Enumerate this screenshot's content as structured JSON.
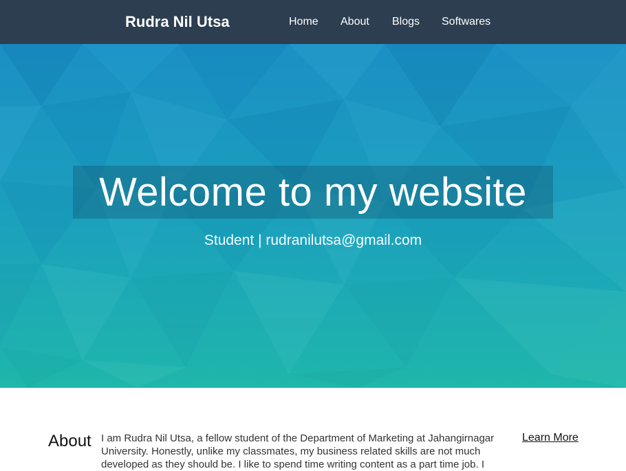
{
  "navbar": {
    "brand": "Rudra Nil Utsa",
    "links": [
      {
        "label": "Home"
      },
      {
        "label": "About"
      },
      {
        "label": "Blogs"
      },
      {
        "label": "Softwares"
      }
    ],
    "background_color": "#2c3e50"
  },
  "hero": {
    "title": "Welcome to my website",
    "subtitle": "Student | rudranilutsa@gmail.com",
    "colors": {
      "top": "#1b8fc4",
      "bottom": "#1fb6ab"
    }
  },
  "about": {
    "heading": "About",
    "text": "I am Rudra Nil Utsa, a fellow student of the Department of Marketing at Jahangirnagar University. Honestly, unlike my classmates, my business related skills are not much developed as they should be. I like to spend time writing content as a part time job. I",
    "learn_more": "Learn More"
  }
}
